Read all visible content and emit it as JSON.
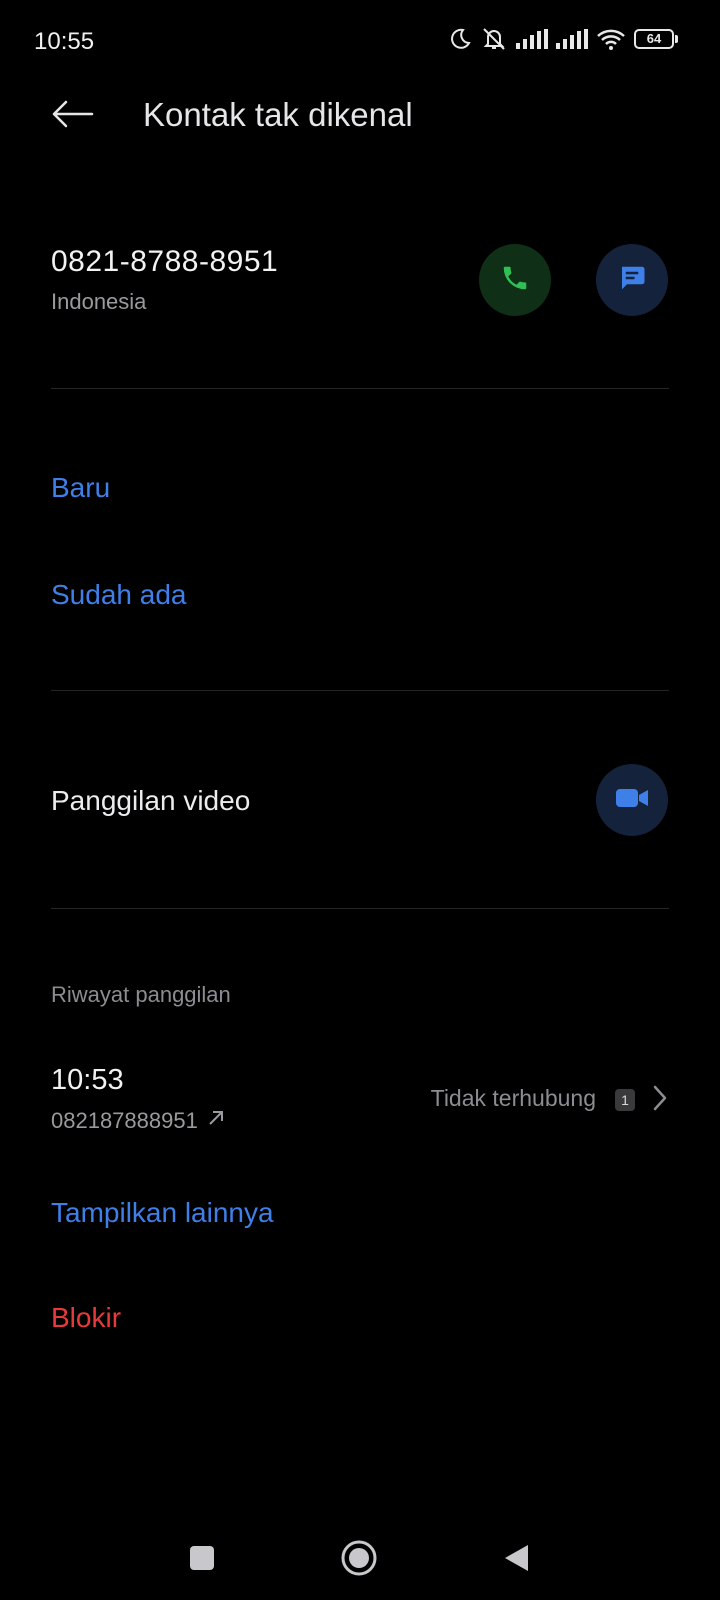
{
  "status_bar": {
    "time": "10:55",
    "battery_level": "64",
    "icons": [
      "moon-icon",
      "muted-bell-icon",
      "signal-icon",
      "signal-icon",
      "wifi-icon",
      "battery-icon"
    ]
  },
  "app_bar": {
    "title": "Kontak tak dikenal",
    "back_icon": "arrow-left-icon"
  },
  "contact": {
    "phone": "0821-8788-8951",
    "country": "Indonesia",
    "call_icon": "phone-icon",
    "message_icon": "message-icon"
  },
  "actions": {
    "new_label": "Baru",
    "existing_label": "Sudah ada"
  },
  "video": {
    "label": "Panggilan video",
    "icon": "video-camera-icon"
  },
  "history": {
    "section_label": "Riwayat panggilan",
    "entries": [
      {
        "time": "10:53",
        "number": "082187888951",
        "status": "Tidak terhubung",
        "count": "1",
        "direction_icon": "outgoing-arrow-icon"
      }
    ],
    "show_more_label": "Tampilkan lainnya"
  },
  "block": {
    "label": "Blokir"
  },
  "colors": {
    "background": "#000000",
    "accent_blue": "#3f7fe8",
    "danger_red": "#e83a3a",
    "call_green": "#2fbf54"
  },
  "nav_bar": {
    "icons": [
      "square-recents-icon",
      "circle-home-icon",
      "triangle-back-icon"
    ]
  }
}
